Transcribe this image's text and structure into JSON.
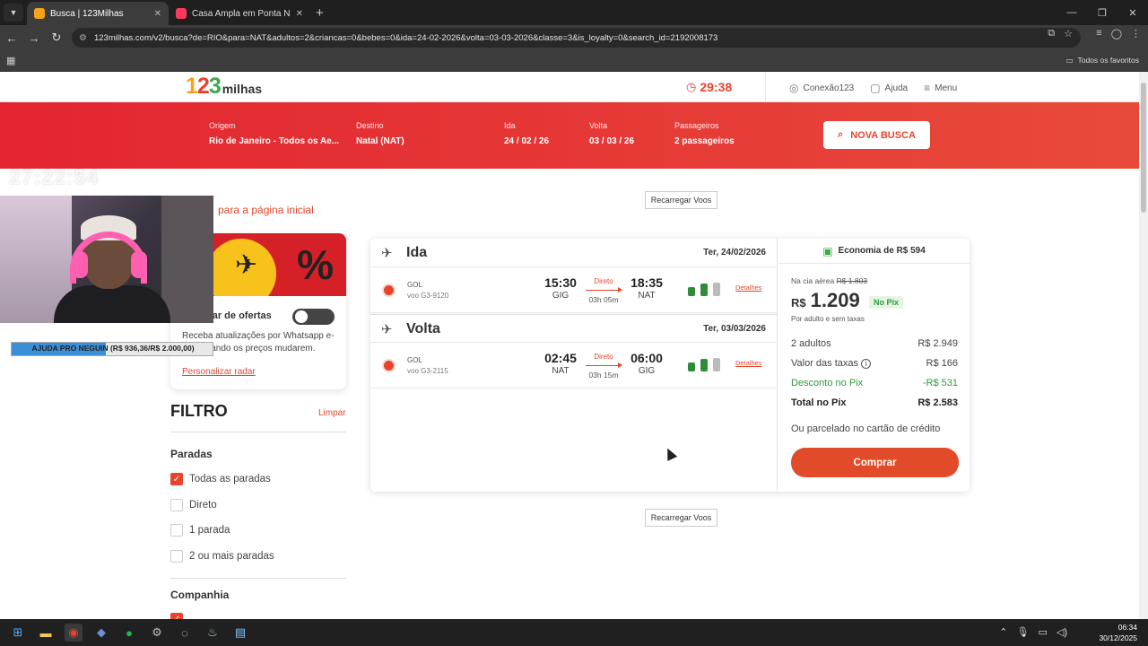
{
  "browser": {
    "tabs": [
      {
        "title": "Busca | 123Milhas",
        "active": true
      },
      {
        "title": "Casa Ampla em Ponta Negra a",
        "active": false
      }
    ],
    "url": "123milhas.com/v2/busca?de=RIO&para=NAT&adultos=2&criancas=0&bebes=0&ida=24-02-2026&volta=03-03-2026&classe=3&is_loyalty=0&search_id=2192008173",
    "bookmarks_folder": "Todos os favoritos"
  },
  "header": {
    "logo_digits": [
      "1",
      "2",
      "3"
    ],
    "logo_word": "milhas",
    "timer": "29:38",
    "links": [
      "Conexão123",
      "Ajuda",
      "Menu"
    ]
  },
  "search": {
    "origem_label": "Origem",
    "origem": "Rio de Janeiro - Todos os Ae...",
    "destino_label": "Destino",
    "destino": "Natal (NAT)",
    "ida_label": "Ida",
    "ida": "24 / 02 / 26",
    "volta_label": "Volta",
    "volta": "03 / 03 / 26",
    "passageiros_label": "Passageiros",
    "passageiros": "2 passageiros",
    "button": "NOVA BUSCA"
  },
  "overlay": {
    "clock": "27:22:54",
    "donation": "AJUDA PRO NEGUIN (R$ 936,36/R$ 2.000,00)",
    "donation_progress": 0.468
  },
  "back_link": "para a página inicial",
  "reload_label": "Recarregar Voos",
  "radar": {
    "title": "dar de ofertas",
    "text": "Receba atualizações por Whatsapp e-mail quando os preços mudarem.",
    "link": "Personalizar radar"
  },
  "filter": {
    "title": "FILTRO",
    "clear": "Limpar",
    "paradas_title": "Paradas",
    "paradas": [
      {
        "label": "Todas as paradas",
        "checked": true
      },
      {
        "label": "Direto",
        "checked": false
      },
      {
        "label": "1 parada",
        "checked": false
      },
      {
        "label": "2 ou mais paradas",
        "checked": false
      }
    ],
    "companhia_title": "Companhia"
  },
  "flights": {
    "ida": {
      "title": "Ida",
      "date": "Ter, 24/02/2026",
      "airline": "GOL",
      "flight": "voo G3-9120",
      "dep_time": "15:30",
      "dep_airport": "GIG",
      "type": "Direto",
      "duration": "03h 05m",
      "arr_time": "18:35",
      "arr_airport": "NAT",
      "details": "Detalhes"
    },
    "volta": {
      "title": "Volta",
      "date": "Ter, 03/03/2026",
      "airline": "GOL",
      "flight": "voo G3-2115",
      "dep_time": "02:45",
      "dep_airport": "NAT",
      "type": "Direto",
      "duration": "03h 15m",
      "arr_time": "06:00",
      "arr_airport": "GIG",
      "details": "Detalhes"
    }
  },
  "price": {
    "economia": "Economia de R$ 594",
    "cia_label": "Na cia aérea",
    "cia_price": "R$ 1.803",
    "currency": "R$",
    "value": "1.209",
    "pix_badge": "No Pix",
    "per": "Por adulto e sem taxas",
    "adults_label": "2 adultos",
    "adults_value": "R$ 2.949",
    "taxes_label": "Valor das taxas",
    "taxes_value": "R$ 166",
    "discount_label": "Desconto no Pix",
    "discount_value": "-R$ 531",
    "total_label": "Total no Pix",
    "total_value": "R$ 2.583",
    "installments": "Ou parcelado no cartão de crédito",
    "buy": "Comprar"
  },
  "taskbar": {
    "time": "06:34",
    "date": "30/12/2025"
  },
  "colors": {
    "brand_red": "#e8442b",
    "band_start": "#e32531",
    "pix_green": "#2e9a3c"
  }
}
